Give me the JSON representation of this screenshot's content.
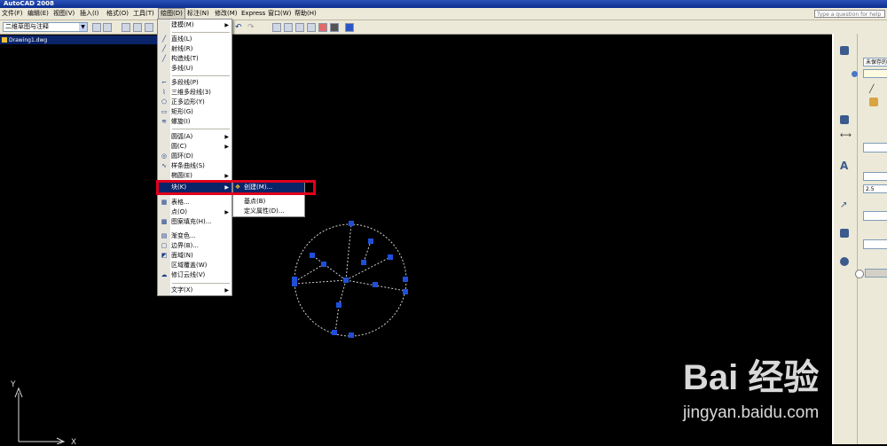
{
  "window": {
    "title": "AutoCAD 2008"
  },
  "menubar": {
    "items": [
      "文件(F)",
      "编辑(E)",
      "视图(V)",
      "插入(I)",
      "格式(O)",
      "工具(T)",
      "绘图(D)",
      "标注(N)",
      "修改(M)",
      "Express",
      "窗口(W)",
      "帮助(H)"
    ],
    "help_placeholder": "Type a question for help"
  },
  "toolbar": {
    "workspace": "二维草图与注释"
  },
  "document": {
    "tab_title": "Drawing1.dwg"
  },
  "draw_menu": {
    "items": [
      {
        "label": "建模(M)",
        "icon": "none",
        "submenu": true
      },
      {
        "label": "直线(L)",
        "icon": "line-icon"
      },
      {
        "label": "射线(R)",
        "icon": "ray-icon"
      },
      {
        "label": "构造线(T)",
        "icon": "xline-icon"
      },
      {
        "label": "多线(U)",
        "icon": "none"
      },
      {
        "label": "多段线(P)",
        "icon": "polyline-icon"
      },
      {
        "label": "三维多段线(3)",
        "icon": "3dpolyline-icon"
      },
      {
        "label": "正多边形(Y)",
        "icon": "polygon-icon"
      },
      {
        "label": "矩形(G)",
        "icon": "rectangle-icon"
      },
      {
        "label": "螺旋(I)",
        "icon": "helix-icon"
      },
      {
        "label": "圆弧(A)",
        "icon": "none",
        "submenu": true
      },
      {
        "label": "圆(C)",
        "icon": "none",
        "submenu": true
      },
      {
        "label": "圆环(D)",
        "icon": "donut-icon"
      },
      {
        "label": "样条曲线(S)",
        "icon": "spline-icon"
      },
      {
        "label": "椭圆(E)",
        "icon": "none",
        "submenu": true
      },
      {
        "label": "块(K)",
        "icon": "none",
        "submenu": true
      },
      {
        "label": "表格...",
        "icon": "table-icon"
      },
      {
        "label": "点(O)",
        "icon": "none",
        "submenu": true
      },
      {
        "label": "图案填充(H)...",
        "icon": "hatch-icon"
      },
      {
        "label": "渐变色...",
        "icon": "gradient-icon"
      },
      {
        "label": "边界(B)...",
        "icon": "boundary-icon"
      },
      {
        "label": "面域(N)",
        "icon": "region-icon"
      },
      {
        "label": "区域覆盖(W)",
        "icon": "none"
      },
      {
        "label": "修订云线(V)",
        "icon": "revcloud-icon"
      },
      {
        "label": "文字(X)",
        "icon": "none",
        "submenu": true
      }
    ]
  },
  "block_submenu": {
    "items": [
      {
        "label": "创建(M)...",
        "icon": "create-block-icon"
      },
      {
        "label": "基点(B)",
        "icon": "none"
      },
      {
        "label": "定义属性(D)...",
        "icon": "none"
      }
    ]
  },
  "palette": {
    "layer_state": "未保存的",
    "text_height": "2.5"
  },
  "ucs": {
    "x_label": "X",
    "y_label": "Y"
  },
  "watermark": {
    "logo": "Bai 经验",
    "url": "jingyan.baidu.com"
  },
  "colors": {
    "accent": "#0a246a",
    "highlight_border": "#e0001a",
    "grip": "#1f4fd9"
  }
}
